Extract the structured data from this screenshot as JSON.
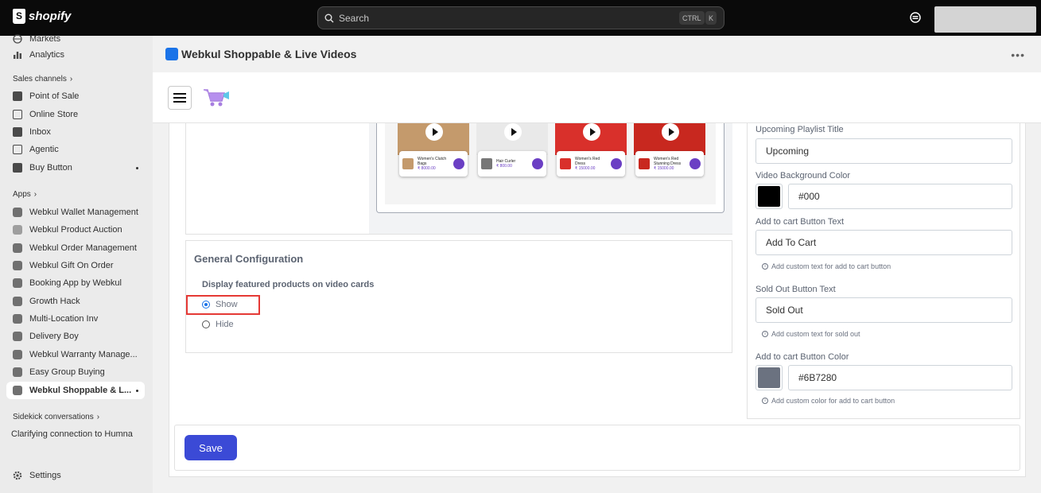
{
  "topbar": {
    "brand": "shopify",
    "search_placeholder": "Search",
    "kbd_ctrl": "CTRL",
    "kbd_k": "K"
  },
  "sidebar": {
    "items_top": [
      {
        "label": "Markets",
        "icon": "globe-icon"
      },
      {
        "label": "Analytics",
        "icon": "bar-chart-icon"
      }
    ],
    "sales_channels_label": "Sales channels",
    "sales_channels": [
      {
        "label": "Point of Sale",
        "icon": "pos-icon"
      },
      {
        "label": "Online Store",
        "icon": "store-icon"
      },
      {
        "label": "Inbox",
        "icon": "inbox-icon"
      },
      {
        "label": "Agentic",
        "icon": "agentic-icon"
      },
      {
        "label": "Buy Button",
        "icon": "buy-button-icon"
      }
    ],
    "apps_label": "Apps",
    "apps": [
      {
        "label": "Webkul Wallet Management"
      },
      {
        "label": "Webkul Product Auction"
      },
      {
        "label": "Webkul Order Management"
      },
      {
        "label": "Webkul Gift On Order"
      },
      {
        "label": "Booking App by Webkul"
      },
      {
        "label": "Growth Hack"
      },
      {
        "label": "Multi-Location Inv"
      },
      {
        "label": "Delivery Boy"
      },
      {
        "label": "Webkul Warranty Manage..."
      },
      {
        "label": "Easy Group Buying"
      },
      {
        "label": "Webkul Shoppable & L..."
      }
    ],
    "sidekick_label": "Sidekick conversations",
    "sidekick_item": "Clarifying connection to Humna",
    "settings_label": "Settings"
  },
  "app_header": {
    "title": "Webkul Shoppable & Live Videos",
    "more": "•••"
  },
  "preview": {
    "cards": [
      {
        "name": "Women's Clutch Bags",
        "price": "₹ 8000.00",
        "color": "#c49a6c"
      },
      {
        "name": "Hair Curler",
        "price": "₹ 800.00",
        "color": "#e9e9e9"
      },
      {
        "name": "Women's Red Dress",
        "price": "₹ 15000.00",
        "color": "#d9302b"
      },
      {
        "name": "Women's Red Stunning Dress",
        "price": "₹ 15000.00",
        "color": "#c8281f"
      }
    ]
  },
  "general": {
    "title": "General Configuration",
    "label": "Display featured products on video cards",
    "option_show": "Show",
    "option_hide": "Hide",
    "selected": "Show"
  },
  "settings": {
    "upcoming_label": "Upcoming Playlist Title",
    "upcoming_value": "Upcoming",
    "video_bg_label": "Video Background Color",
    "video_bg_value": "#000",
    "atc_text_label": "Add to cart Button Text",
    "atc_text_value": "Add To Cart",
    "atc_text_help": "Add custom text for add to cart button",
    "sold_out_label": "Sold Out Button Text",
    "sold_out_value": "Sold Out",
    "sold_out_help": "Add custom text for sold out",
    "atc_color_label": "Add to cart Button Color",
    "atc_color_value": "#6B7280",
    "atc_color_help": "Add custom color for add to cart button"
  },
  "actions": {
    "save_label": "Save"
  },
  "colors": {
    "accent": "#3b4ad6",
    "highlight": "#e53935",
    "swatch_black": "#000000",
    "swatch_gray": "#6B7280"
  }
}
